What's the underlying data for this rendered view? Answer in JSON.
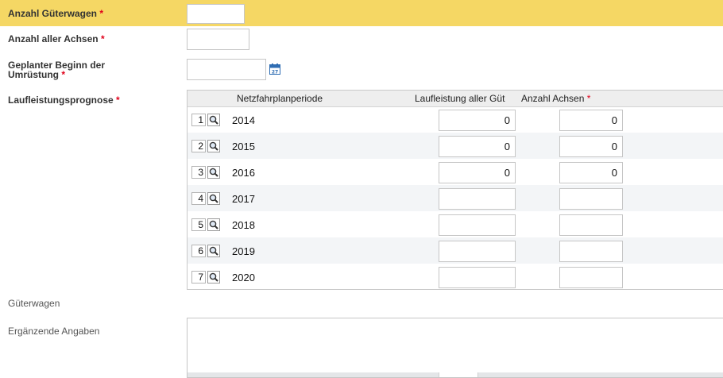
{
  "fields": {
    "wagons_label": "Anzahl Güterwagen",
    "wagons_value": "",
    "axles_label": "Anzahl aller Achsen",
    "axles_value": "",
    "start_label_line1": "Geplanter Beginn der",
    "start_label_line2": "Umrüstung",
    "start_value": "",
    "calendar_day": "27",
    "forecast_label": "Laufleistungsprognose",
    "required_mark": "*"
  },
  "grid": {
    "headers": {
      "period": "Netzfahrplanperiode",
      "mileage": "Laufleistung aller Güt",
      "axles": "Anzahl Achsen",
      "axles_required": "*"
    },
    "rows": [
      {
        "num": "1",
        "year": "2014",
        "mileage": "0",
        "axles": "0"
      },
      {
        "num": "2",
        "year": "2015",
        "mileage": "0",
        "axles": "0"
      },
      {
        "num": "3",
        "year": "2016",
        "mileage": "0",
        "axles": "0"
      },
      {
        "num": "4",
        "year": "2017",
        "mileage": "",
        "axles": ""
      },
      {
        "num": "5",
        "year": "2018",
        "mileage": "",
        "axles": ""
      },
      {
        "num": "6",
        "year": "2019",
        "mileage": "",
        "axles": ""
      },
      {
        "num": "7",
        "year": "2020",
        "mileage": "",
        "axles": ""
      }
    ]
  },
  "footer": {
    "wagons_section": "Güterwagen",
    "extra_label": "Ergänzende Angaben",
    "extra_value": ""
  },
  "colors": {
    "highlight": "#f5d764",
    "required": "#e0001a",
    "row_alt": "#f3f5f7",
    "calendar_blue": "#2f6db3"
  },
  "icons": [
    "calendar-icon",
    "magnifier-icon"
  ]
}
